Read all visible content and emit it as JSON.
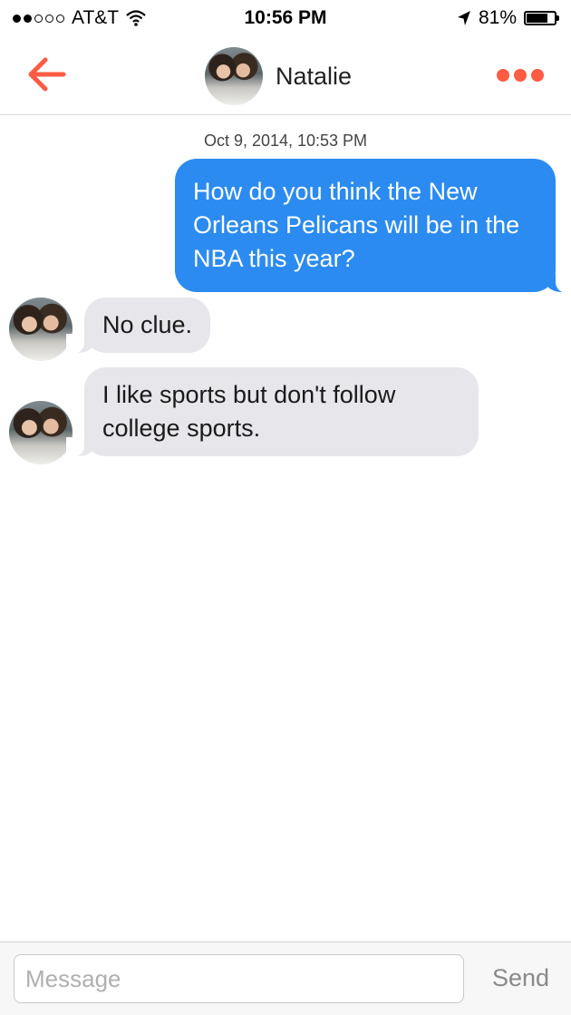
{
  "status_bar": {
    "carrier": "AT&T",
    "time": "10:56 PM",
    "battery": "81%",
    "battery_level": 0.81,
    "signal_bars_filled": 2,
    "signal_bars_total": 5,
    "icons": [
      "wifi-icon",
      "location-arrow-icon",
      "battery-icon"
    ]
  },
  "nav": {
    "contact_name": "Natalie",
    "back_icon": "arrow-left-icon",
    "more_icon": "more-dots-icon",
    "accent_color": "#fd5b42"
  },
  "conversation": {
    "timestamp": "Oct 9, 2014, 10:53 PM",
    "messages": [
      {
        "direction": "outgoing",
        "text": "How do you think the New Orleans Pelicans will be in the NBA this year?"
      },
      {
        "direction": "incoming",
        "text": "No clue."
      },
      {
        "direction": "incoming",
        "text": "I like sports but don't follow college sports."
      }
    ],
    "outgoing_color": "#2b8bf0",
    "incoming_color": "#e6e6eb"
  },
  "composer": {
    "placeholder": "Message",
    "value": "",
    "send_label": "Send"
  }
}
